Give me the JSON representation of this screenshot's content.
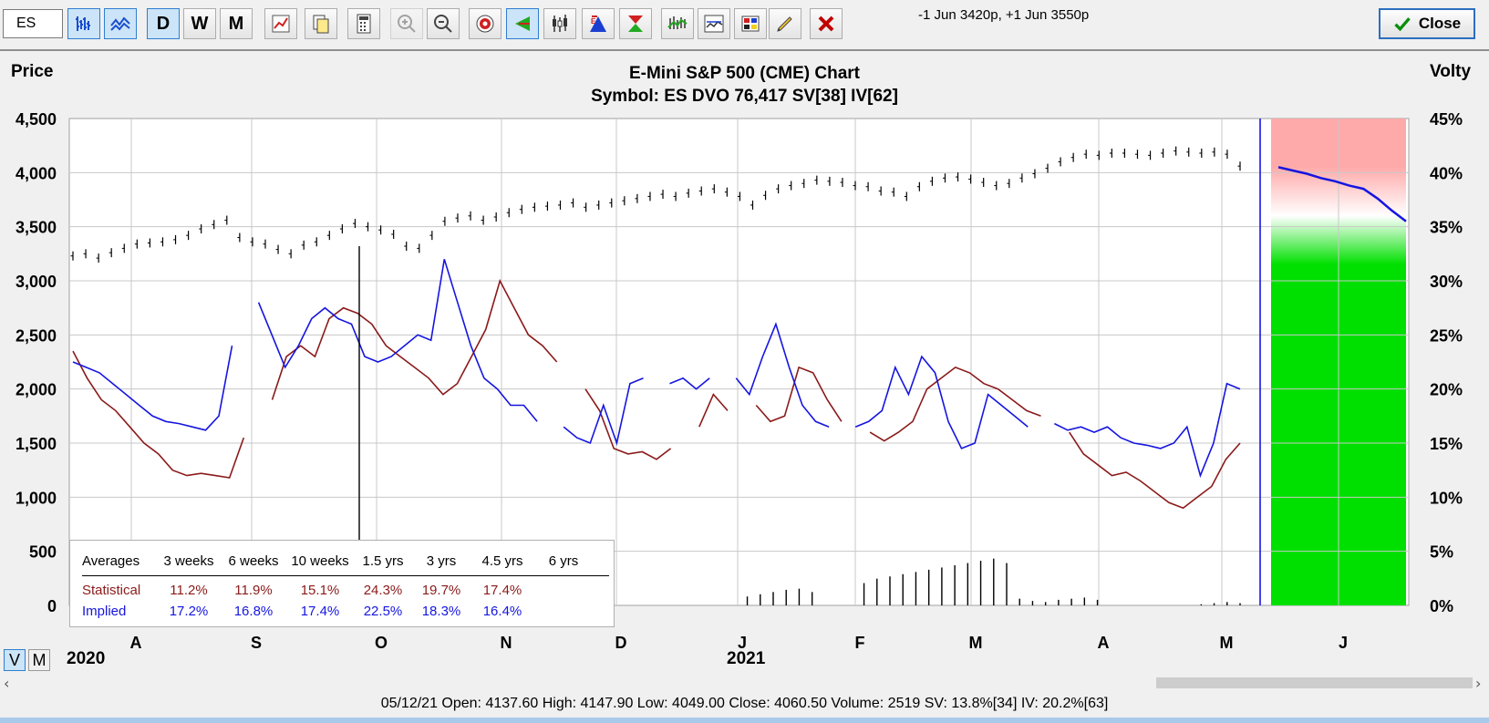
{
  "toolbar": {
    "symbol_value": "ES",
    "period_buttons": [
      "D",
      "W",
      "M"
    ],
    "strike_info": "-1 Jun 3420p, +1 Jun 3550p",
    "close_label": "Close",
    "icons": [
      "bar-chart-icon",
      "line-chart-icon",
      "chart-settings-icon",
      "copy-icon",
      "calculator-icon",
      "zoom-in-icon",
      "zoom-out-icon",
      "target-icon",
      "triangle-icon",
      "candle-icon",
      "up-triangle-icon",
      "hourglass-icon",
      "volatility-icon",
      "compare-icon",
      "palette-icon",
      "pencil-icon",
      "delete-icon"
    ]
  },
  "chart": {
    "title": "E-Mini S&P 500 (CME) Chart",
    "subtitle": "Symbol: ES  DVO 76,417   SV[38]  IV[62]",
    "left_axis_title": "Price",
    "right_axis_title": "Volty",
    "view_toggle": [
      "V",
      "M"
    ]
  },
  "chart_data": {
    "type": "line",
    "x_labels": [
      "A",
      "S",
      "O",
      "N",
      "D",
      "J",
      "F",
      "M",
      "A",
      "M",
      "J"
    ],
    "year_labels": [
      "2020",
      "2021"
    ],
    "y_left": {
      "title": "Price",
      "range": [
        0,
        4500
      ],
      "ticks": [
        "4,500",
        "4,000",
        "3,500",
        "3,000",
        "2,500",
        "2,000",
        "1,500",
        "1,000",
        "500",
        "0"
      ]
    },
    "y_right": {
      "title": "Volty",
      "range": [
        0,
        45
      ],
      "ticks": [
        "45%",
        "40%",
        "35%",
        "30%",
        "25%",
        "20%",
        "15%",
        "10%",
        "5%",
        "0%"
      ]
    },
    "grid": true,
    "series": [
      {
        "name": "Price",
        "axis": "left",
        "color": "#000000",
        "style": "ohlc",
        "values": [
          3230,
          3250,
          3210,
          3260,
          3300,
          3340,
          3350,
          3360,
          3380,
          3420,
          3480,
          3520,
          3560,
          3400,
          3360,
          3340,
          3290,
          3250,
          3330,
          3360,
          3420,
          3480,
          3530,
          3500,
          3470,
          3430,
          3320,
          3300,
          3420,
          3550,
          3580,
          3600,
          3560,
          3590,
          3630,
          3660,
          3680,
          3690,
          3700,
          3720,
          3680,
          3700,
          3720,
          3740,
          3760,
          3780,
          3800,
          3780,
          3810,
          3830,
          3850,
          3820,
          3780,
          3700,
          3790,
          3850,
          3880,
          3900,
          3930,
          3920,
          3910,
          3880,
          3870,
          3830,
          3820,
          3780,
          3870,
          3920,
          3950,
          3960,
          3940,
          3910,
          3880,
          3900,
          3950,
          3990,
          4040,
          4100,
          4140,
          4170,
          4160,
          4180,
          4180,
          4170,
          4160,
          4180,
          4200,
          4190,
          4180,
          4190,
          4170,
          4060
        ]
      },
      {
        "name": "Statistical",
        "axis": "right",
        "color": "#8b1a1a",
        "style": "line",
        "values": [
          23.5,
          21,
          19,
          18,
          16.5,
          15,
          14,
          12.5,
          12,
          12.2,
          12,
          11.8,
          15.5,
          null,
          19,
          23,
          24,
          23,
          26.5,
          27.5,
          27,
          26,
          24,
          23,
          22,
          21,
          19.5,
          20.5,
          23,
          25.5,
          30,
          27.5,
          25,
          24,
          22.5,
          null,
          20,
          18,
          14.5,
          14,
          14.2,
          13.5,
          14.5,
          null,
          16.5,
          19.5,
          18,
          null,
          18.5,
          17,
          17.5,
          22,
          21.5,
          19,
          17,
          null,
          16,
          15.2,
          16,
          17,
          20,
          21,
          22,
          21.5,
          20.5,
          20,
          19,
          18,
          17.5,
          null,
          16,
          14,
          13,
          12,
          12.3,
          11.5,
          10.5,
          9.5,
          9,
          10,
          11,
          13.5,
          15
        ]
      },
      {
        "name": "Implied",
        "axis": "right",
        "color": "#1515e0",
        "style": "line",
        "values": [
          22.5,
          22,
          21.5,
          20.5,
          19.5,
          18.5,
          17.5,
          17,
          16.8,
          16.5,
          16.2,
          17.5,
          24,
          null,
          28,
          25,
          22,
          24,
          26.5,
          27.5,
          26.5,
          26,
          23,
          22.5,
          23,
          24,
          25,
          24.5,
          32,
          28,
          24,
          21,
          20,
          18.5,
          18.5,
          17,
          null,
          16.5,
          15.5,
          15,
          18.5,
          15,
          20.5,
          21,
          null,
          20.5,
          21,
          20,
          21,
          null,
          21,
          19.5,
          23,
          26,
          22,
          18.5,
          17,
          16.5,
          null,
          16.5,
          17,
          18,
          22,
          19.5,
          23,
          21.5,
          17,
          14.5,
          15,
          19.5,
          18.5,
          17.5,
          16.5,
          null,
          16.8,
          16.2,
          16.5,
          16,
          16.5,
          15.5,
          15,
          14.8,
          14.5,
          15,
          16.5,
          12,
          15,
          20.5,
          20
        ]
      },
      {
        "name": "Projected Volty",
        "axis": "right",
        "color": "#1515e0",
        "style": "line",
        "values": [
          40.5,
          40.2,
          39.9,
          39.5,
          39.2,
          38.8,
          38.5,
          37.6,
          36.5,
          35.5
        ]
      }
    ],
    "volume_bars": [
      0,
      0,
      0,
      0,
      0,
      0,
      0,
      0,
      0,
      0,
      0,
      0,
      0,
      0,
      0,
      0,
      0,
      0,
      0,
      0,
      0,
      0,
      0,
      0,
      0,
      0,
      0,
      0,
      0,
      0,
      0,
      0,
      0,
      0,
      0,
      0,
      1,
      2,
      4,
      5,
      6,
      4,
      0,
      0,
      0,
      0,
      0,
      0,
      0,
      0,
      0,
      0,
      8,
      10,
      12,
      14,
      15,
      12,
      0,
      0,
      0,
      20,
      24,
      26,
      28,
      30,
      32,
      34,
      36,
      38,
      40,
      42,
      38,
      6,
      4,
      3,
      5,
      6,
      7,
      5,
      0,
      0,
      0,
      0,
      0,
      0,
      0,
      1,
      2,
      3,
      2
    ],
    "averages_table": {
      "columns": [
        "Averages",
        "3 weeks",
        "6 weeks",
        "10 weeks",
        "1.5 yrs",
        "3 yrs",
        "4.5 yrs",
        "6 yrs"
      ],
      "rows": [
        {
          "label": "Statistical",
          "values": [
            "11.2%",
            "11.9%",
            "15.1%",
            "24.3%",
            "19.7%",
            "17.4%",
            ""
          ],
          "color": "#8b1a1a"
        },
        {
          "label": "Implied",
          "values": [
            "17.2%",
            "16.8%",
            "17.4%",
            "22.5%",
            "18.3%",
            "16.4%",
            ""
          ],
          "color": "#1515e0"
        }
      ]
    }
  },
  "colors": {
    "projection_red": "#ffaaaa",
    "projection_green": "#00e000",
    "cursor_blue": "#1515e0"
  },
  "status": {
    "text": "05/12/21   Open: 4137.60   High: 4147.90   Low: 4049.00   Close: 4060.50   Volume: 2519   SV: 13.8%[34]   IV: 20.2%[63]"
  }
}
